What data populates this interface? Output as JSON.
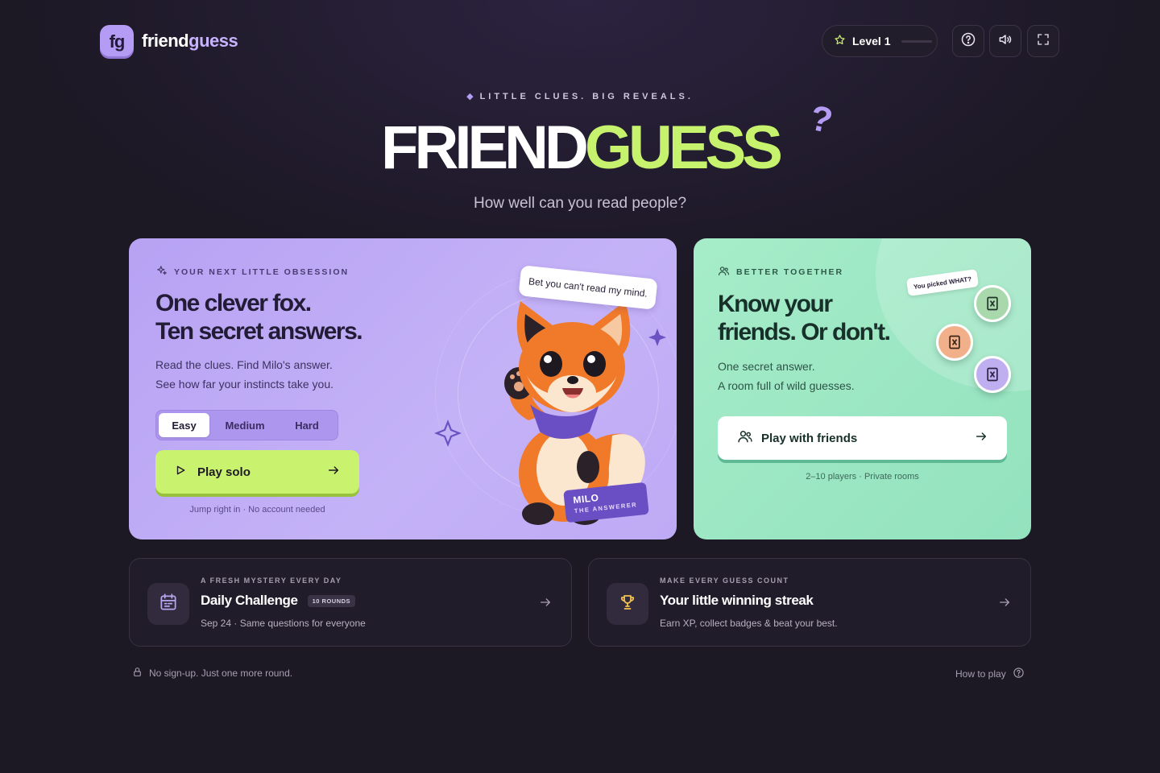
{
  "header": {
    "logo_mark": "fg",
    "logo_text_a": "friend",
    "logo_text_b": "guess",
    "level_label": "Level 1",
    "level_progress": 0,
    "icons": [
      "help-icon",
      "sound-icon",
      "fullscreen-icon"
    ]
  },
  "hero": {
    "tagline": "LITTLE CLUES. BIG REVEALS.",
    "title_part1": "FRIEND",
    "title_part2": "GUESS",
    "title_mark": "?",
    "subtitle": "How well can you read people?"
  },
  "solo": {
    "eyebrow": "YOUR NEXT LITTLE OBSESSION",
    "title_line1": "One clever fox.",
    "title_line2": "Ten secret answers.",
    "desc_line1": "Read the clues. Find Milo's answer.",
    "desc_line2": "See how far your instincts take you.",
    "difficulty": [
      "Easy",
      "Medium",
      "Hard"
    ],
    "selected_difficulty": "Easy",
    "play_label": "Play solo",
    "note": "Jump right in · No account needed",
    "speech": "Bet you can't read my mind.",
    "mascot_name": "MILO",
    "mascot_role": "THE ANSWERER"
  },
  "friends": {
    "eyebrow": "BETTER TOGETHER",
    "title_line1": "Know your",
    "title_line2": "friends. Or don't.",
    "desc_line1": "One secret answer.",
    "desc_line2": "A room full of wild guesses.",
    "bubble": "You picked WHAT?",
    "play_label": "Play with friends",
    "note": "2–10 players · Private rooms"
  },
  "daily": {
    "eyebrow": "A FRESH MYSTERY EVERY DAY",
    "title": "Daily Challenge",
    "badge": "10 ROUNDS",
    "desc": "Sep 24 · Same questions for everyone"
  },
  "streak": {
    "eyebrow": "MAKE EVERY GUESS COUNT",
    "title": "Your little winning streak",
    "desc": "Earn XP, collect badges & beat your best."
  },
  "footer": {
    "left": "No sign-up. Just one more round.",
    "right": "How to play"
  },
  "colors": {
    "background": "#1c1824",
    "accent_lime": "#c6f26d",
    "accent_purple": "#b49cf5",
    "mint": "#a6ecc9"
  }
}
